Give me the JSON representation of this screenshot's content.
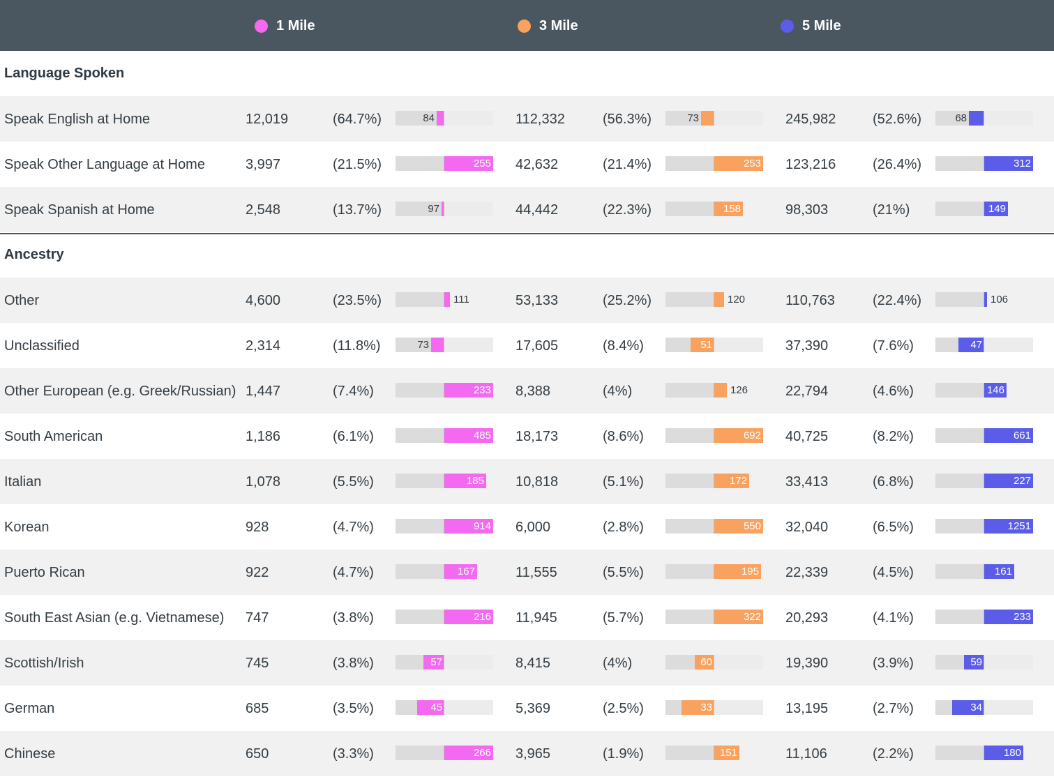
{
  "header": {
    "columns": [
      {
        "label": "1 Mile",
        "color": "#f36af1"
      },
      {
        "label": "3 Mile",
        "color": "#f9a15e"
      },
      {
        "label": "5 Mile",
        "color": "#5b5de8"
      }
    ]
  },
  "colors": {
    "one_mile": "#f36af1",
    "three_mile": "#f9a15e",
    "five_mile": "#5b5de8",
    "header_bg": "#4a5660"
  },
  "chart_data": {
    "type": "table",
    "index_baseline": 100,
    "bar_range": [
      0,
      200
    ],
    "columns": [
      "1 Mile",
      "3 Mile",
      "5 Mile"
    ],
    "sections": [
      {
        "title": "Language Spoken",
        "rows": [
          {
            "label": "Speak English at Home",
            "cells": [
              {
                "count": "12,019",
                "pct": "(64.7%)",
                "index": 84
              },
              {
                "count": "112,332",
                "pct": "(56.3%)",
                "index": 73
              },
              {
                "count": "245,982",
                "pct": "(52.6%)",
                "index": 68
              }
            ]
          },
          {
            "label": "Speak Other Language at Home",
            "cells": [
              {
                "count": "3,997",
                "pct": "(21.5%)",
                "index": 255
              },
              {
                "count": "42,632",
                "pct": "(21.4%)",
                "index": 253
              },
              {
                "count": "123,216",
                "pct": "(26.4%)",
                "index": 312
              }
            ]
          },
          {
            "label": "Speak Spanish at Home",
            "cells": [
              {
                "count": "2,548",
                "pct": "(13.7%)",
                "index": 97
              },
              {
                "count": "44,442",
                "pct": "(22.3%)",
                "index": 158
              },
              {
                "count": "98,303",
                "pct": "(21%)",
                "index": 149
              }
            ]
          }
        ]
      },
      {
        "title": "Ancestry",
        "rows": [
          {
            "label": "Other",
            "cells": [
              {
                "count": "4,600",
                "pct": "(23.5%)",
                "index": 111
              },
              {
                "count": "53,133",
                "pct": "(25.2%)",
                "index": 120
              },
              {
                "count": "110,763",
                "pct": "(22.4%)",
                "index": 106
              }
            ]
          },
          {
            "label": "Unclassified",
            "cells": [
              {
                "count": "2,314",
                "pct": "(11.8%)",
                "index": 73
              },
              {
                "count": "17,605",
                "pct": "(8.4%)",
                "index": 51
              },
              {
                "count": "37,390",
                "pct": "(7.6%)",
                "index": 47
              }
            ]
          },
          {
            "label": "Other European (e.g. Greek/Russian)",
            "cells": [
              {
                "count": "1,447",
                "pct": "(7.4%)",
                "index": 233
              },
              {
                "count": "8,388",
                "pct": "(4%)",
                "index": 126
              },
              {
                "count": "22,794",
                "pct": "(4.6%)",
                "index": 146
              }
            ]
          },
          {
            "label": "South American",
            "cells": [
              {
                "count": "1,186",
                "pct": "(6.1%)",
                "index": 485
              },
              {
                "count": "18,173",
                "pct": "(8.6%)",
                "index": 692
              },
              {
                "count": "40,725",
                "pct": "(8.2%)",
                "index": 661
              }
            ]
          },
          {
            "label": "Italian",
            "cells": [
              {
                "count": "1,078",
                "pct": "(5.5%)",
                "index": 185
              },
              {
                "count": "10,818",
                "pct": "(5.1%)",
                "index": 172
              },
              {
                "count": "33,413",
                "pct": "(6.8%)",
                "index": 227
              }
            ]
          },
          {
            "label": "Korean",
            "cells": [
              {
                "count": "928",
                "pct": "(4.7%)",
                "index": 914
              },
              {
                "count": "6,000",
                "pct": "(2.8%)",
                "index": 550
              },
              {
                "count": "32,040",
                "pct": "(6.5%)",
                "index": 1251
              }
            ]
          },
          {
            "label": "Puerto Rican",
            "cells": [
              {
                "count": "922",
                "pct": "(4.7%)",
                "index": 167
              },
              {
                "count": "11,555",
                "pct": "(5.5%)",
                "index": 195
              },
              {
                "count": "22,339",
                "pct": "(4.5%)",
                "index": 161
              }
            ]
          },
          {
            "label": "South East Asian (e.g. Vietnamese)",
            "cells": [
              {
                "count": "747",
                "pct": "(3.8%)",
                "index": 216
              },
              {
                "count": "11,945",
                "pct": "(5.7%)",
                "index": 322
              },
              {
                "count": "20,293",
                "pct": "(4.1%)",
                "index": 233
              }
            ]
          },
          {
            "label": "Scottish/Irish",
            "cells": [
              {
                "count": "745",
                "pct": "(3.8%)",
                "index": 57
              },
              {
                "count": "8,415",
                "pct": "(4%)",
                "index": 60
              },
              {
                "count": "19,390",
                "pct": "(3.9%)",
                "index": 59
              }
            ]
          },
          {
            "label": "German",
            "cells": [
              {
                "count": "685",
                "pct": "(3.5%)",
                "index": 45
              },
              {
                "count": "5,369",
                "pct": "(2.5%)",
                "index": 33
              },
              {
                "count": "13,195",
                "pct": "(2.7%)",
                "index": 34
              }
            ]
          },
          {
            "label": "Chinese",
            "cells": [
              {
                "count": "650",
                "pct": "(3.3%)",
                "index": 266
              },
              {
                "count": "3,965",
                "pct": "(1.9%)",
                "index": 151
              },
              {
                "count": "11,106",
                "pct": "(2.2%)",
                "index": 180
              }
            ]
          }
        ]
      }
    ]
  }
}
